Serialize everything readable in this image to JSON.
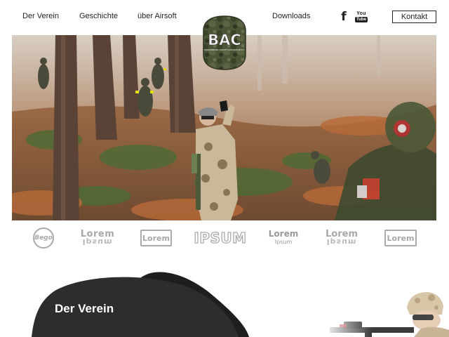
{
  "nav": {
    "links": [
      "Der Verein",
      "Geschichte",
      "über Airsoft",
      "Downloads"
    ],
    "social": [
      {
        "icon": "facebook-icon",
        "glyph": "f"
      },
      {
        "icon": "youtube-icon",
        "you": "You",
        "tube": "Tube"
      }
    ],
    "contact_label": "Kontakt"
  },
  "logo": {
    "letters": "BAC",
    "tagline": "BRANDENBURG AIRSOFT CORPORATION E.V."
  },
  "brands": [
    {
      "text": "Bego"
    },
    {
      "text": "Lorem",
      "sub": "Ipsum"
    },
    {
      "text": "Lorem"
    },
    {
      "text": "IPSUM"
    },
    {
      "text": "Lorem",
      "sub": "Ipsum"
    },
    {
      "text": "Lorem",
      "sub": "Ipsum"
    },
    {
      "text": "Lorem"
    }
  ],
  "section": {
    "title": "Der Verein"
  },
  "colors": {
    "text": "#222222",
    "blob_dark": "#1e1e1e",
    "blob_mid": "#2d2d2d",
    "logo_green": "#4a5535",
    "brand_gray": "#a8a8a8"
  }
}
